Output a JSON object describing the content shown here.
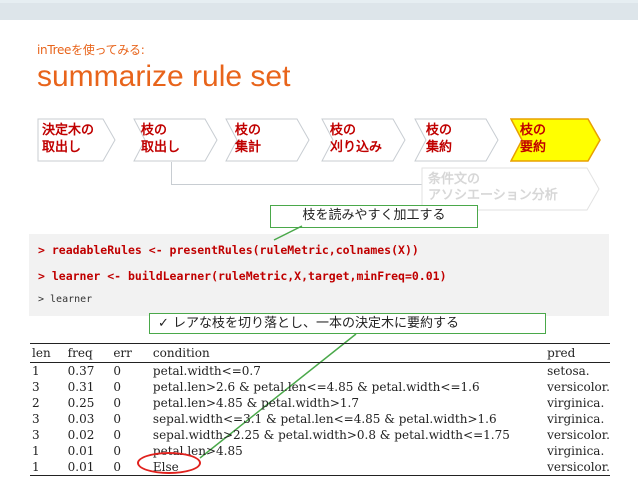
{
  "header": {
    "subtitle": "inTreeを使ってみる:",
    "title": "summarize rule set"
  },
  "steps": [
    {
      "label": "決定木の\n取出し",
      "highlight": false
    },
    {
      "label": "枝の\n取出し",
      "highlight": false
    },
    {
      "label": "枝の\n集計",
      "highlight": false
    },
    {
      "label": "枝の\n刈り込み",
      "highlight": false
    },
    {
      "label": "枝の\n集約",
      "highlight": false
    },
    {
      "label": "枝の\n要約",
      "highlight": true
    }
  ],
  "branch_step": {
    "label": "条件文の\nアソシエーション分析"
  },
  "callouts": {
    "top": "枝を読みやすく加工する",
    "bottom": "✓ レアな枝を切り落とし、一本の決定木に要約する"
  },
  "code": {
    "line1": "> readableRules <- presentRules(ruleMetric,colnames(X))",
    "line2": "> learner <- buildLearner(ruleMetric,X,target,minFreq=0.01)",
    "line3": "> learner"
  },
  "table": {
    "headers": [
      "len",
      "freq",
      "err",
      "condition",
      "pred"
    ],
    "rows": [
      [
        "1",
        "0.37",
        "0",
        "petal.width<=0.7",
        "setosa."
      ],
      [
        "3",
        "0.31",
        "0",
        "petal.len>2.6 & petal.len<=4.85 & petal.width<=1.6",
        "versicolor."
      ],
      [
        "2",
        "0.25",
        "0",
        "petal.len>4.85 & petal.width>1.7",
        "virginica."
      ],
      [
        "3",
        "0.03",
        "0",
        "sepal.width<=3.1 & petal.len<=4.85 & petal.width>1.6",
        "virginica."
      ],
      [
        "3",
        "0.02",
        "0",
        "sepal.width>2.25 & petal.width>0.8 & petal.width<=1.75",
        "versicolor."
      ],
      [
        "1",
        "0.01",
        "0",
        "petal.len>4.85",
        "virginica."
      ],
      [
        "1",
        "0.01",
        "0",
        "Else",
        "versicolor."
      ]
    ]
  },
  "colors": {
    "accent": "#e8641b",
    "step_text": "#c00000",
    "highlight_fill": "#ffff00",
    "highlight_border": "#e8a000",
    "callout_border": "#4aa84a",
    "ellipse": "#e0221e"
  }
}
